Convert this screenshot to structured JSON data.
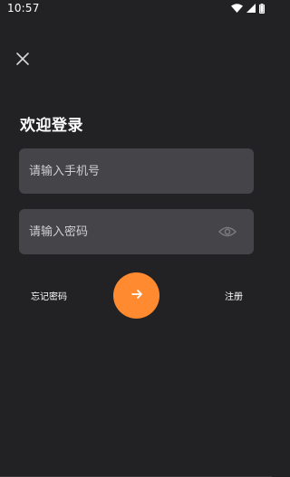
{
  "status_bar": {
    "time": "10:57",
    "icons": [
      "wifi-icon",
      "signal-icon",
      "battery-icon"
    ]
  },
  "header": {
    "close_icon": "close-icon"
  },
  "login": {
    "title": "欢迎登录",
    "phone_placeholder": "请输入手机号",
    "phone_value": "",
    "password_placeholder": "请输入密码",
    "password_value": "",
    "password_toggle_icon": "eye-icon",
    "forgot_label": "忘记密码",
    "register_label": "注册",
    "submit_icon": "arrow-right-icon"
  },
  "colors": {
    "background": "#222123",
    "field_background": "#454449",
    "accent": "#ff8a30",
    "text": "#ffffff",
    "placeholder": "#cfcfd2"
  }
}
